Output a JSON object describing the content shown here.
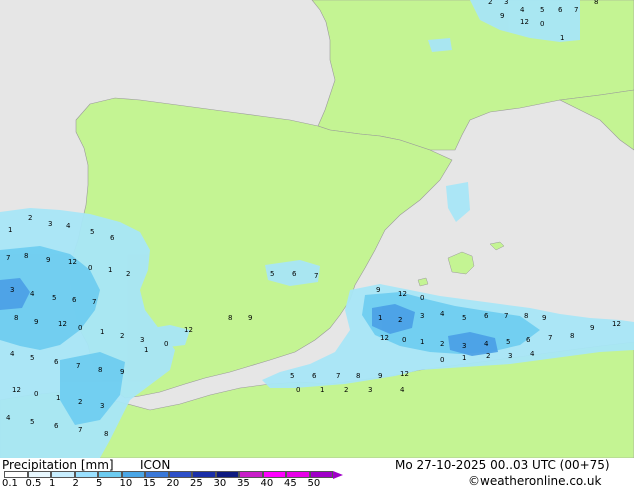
{
  "footer": {
    "title": "Precipitation [mm]",
    "model": "ICON",
    "datetime": "Mo 27-10-2025 00..03 UTC (00+75)",
    "credit": "©weatheronline.co.uk"
  },
  "scale": {
    "labels": [
      "0.1",
      "0.5",
      "1",
      "2",
      "5",
      "10",
      "15",
      "20",
      "25",
      "30",
      "35",
      "40",
      "45",
      "50"
    ],
    "colors": [
      "#ffffff",
      "#e8f8ff",
      "#c8eeff",
      "#9ae0ff",
      "#6ccbf0",
      "#4aa6e6",
      "#3a78d8",
      "#2d4fc8",
      "#1a2fa8",
      "#0e1a80",
      "#c81ec8",
      "#ff00ff",
      "#e800e8",
      "#a000c8"
    ]
  },
  "colors": {
    "sea": "#e6e6e6",
    "land": "#c4f493",
    "rain_light": "#a8e6f7",
    "rain_mid": "#6fcdf0",
    "rain_heavy": "#4a9fe6"
  },
  "rain_values": [
    "1",
    "2",
    "3",
    "4",
    "5",
    "6",
    "7",
    "8",
    "9",
    "12",
    "0"
  ]
}
